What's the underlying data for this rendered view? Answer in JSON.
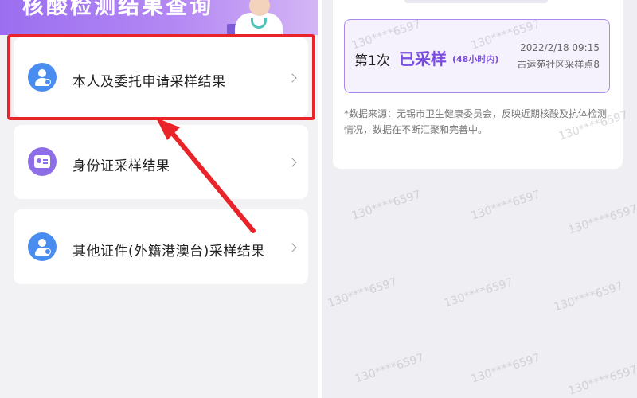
{
  "left": {
    "banner_title": "核酸检测结果查询",
    "items": [
      {
        "label": "本人及委托申请采样结果",
        "icon": "user-icon"
      },
      {
        "label": "身份证采样结果",
        "icon": "id-card-icon"
      },
      {
        "label": "其他证件(外籍港澳台)采样结果",
        "icon": "user-icon"
      }
    ],
    "highlight_color": "#e8232a"
  },
  "right": {
    "record": {
      "count": "第1次",
      "status": "已采样",
      "validity": "(48小时内)",
      "date": "2022/2/18 09:15",
      "place": "古运苑社区采样点8"
    },
    "footnote": "*数据来源：无锡市卫生健康委员会，反映近期核酸及抗体检测情况，数据在不断汇聚和完善中。",
    "watermark": "130****6597"
  },
  "colors": {
    "accent": "#7a4de0",
    "banner_start": "#9b6ef0",
    "user_icon": "#4a8df0",
    "id_icon": "#8e6ee6"
  }
}
